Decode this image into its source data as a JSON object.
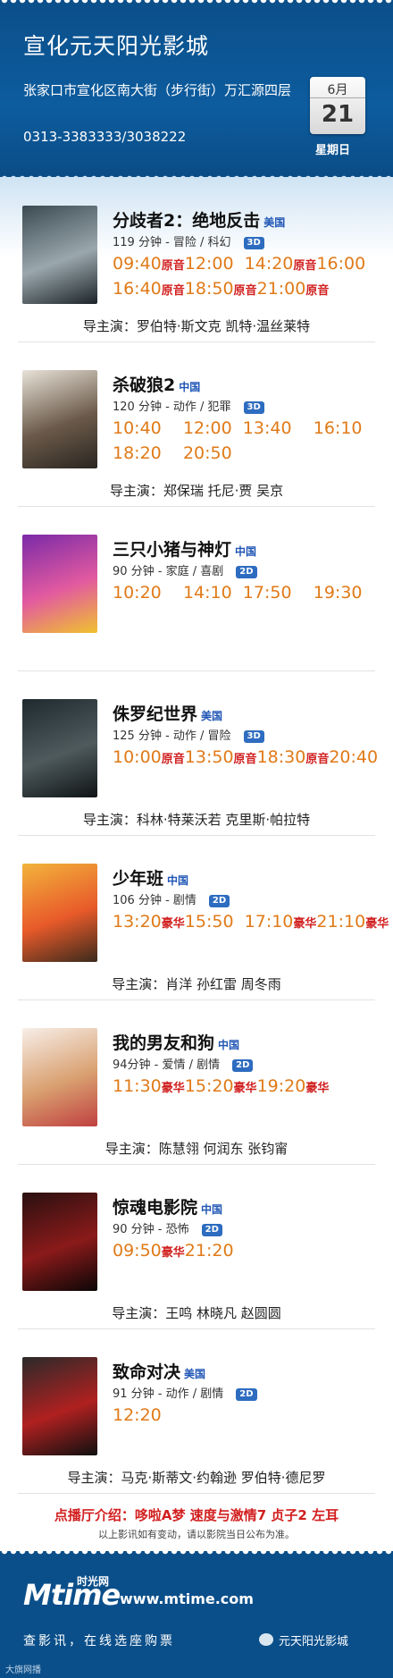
{
  "header": {
    "title": "宣化元天阳光影城",
    "address": "张家口市宣化区南大街（步行街）万汇源四层",
    "phone": "0313-3383333/3038222",
    "month": "6月",
    "day": "21",
    "weekday": "星期日"
  },
  "movies": [
    {
      "title": "分歧者2：绝地反击",
      "country": "美国",
      "meta": "119 分钟 - 冒险 / 科幻",
      "format": "3D",
      "poster_colors": [
        "#3b4a52",
        "#9aa7ad",
        "#1c2428"
      ],
      "times_line1": [
        "09:40",
        "原音",
        "12:00",
        "14:20",
        "原音",
        "16:00"
      ],
      "times_line2": [
        "16:40",
        "原音",
        "18:50",
        "原音",
        "21:00",
        "原音"
      ],
      "cast": "导主演：罗伯特·斯文克 凯特·温丝莱特"
    },
    {
      "title": "杀破狼2",
      "country": "中国",
      "meta": "120 分钟 - 动作 / 犯罪",
      "format": "3D",
      "poster_colors": [
        "#e8e2d8",
        "#6b5a4a",
        "#2a2520"
      ],
      "times_line1": [
        "10:40",
        "",
        "12:00",
        "13:40",
        "",
        "16:10"
      ],
      "times_line2": [
        "18:20",
        "",
        "20:50",
        "",
        "",
        ""
      ],
      "cast": "导主演：郑保瑞 托尼·贾 吴京"
    },
    {
      "title": "三只小猪与神灯",
      "country": "中国",
      "meta": "90 分钟 - 家庭 / 喜剧",
      "format": "2D",
      "poster_colors": [
        "#7a2aa8",
        "#e25aa0",
        "#f0c22e"
      ],
      "times_line1": [
        "10:20",
        "",
        "14:10",
        "17:50",
        "",
        "19:30"
      ],
      "times_line2": [],
      "cast": ""
    },
    {
      "title": "侏罗纪世界",
      "country": "美国",
      "meta": "125 分钟 - 动作 / 冒险",
      "format": "3D",
      "poster_colors": [
        "#1f2a2e",
        "#4e5a5c",
        "#0f1416"
      ],
      "times_line1": [
        "10:00",
        "原音",
        "13:50",
        "原音",
        "18:30",
        "原音",
        "20:40"
      ],
      "times_line2": [],
      "cast": "导主演：科林·特莱沃若 克里斯·帕拉特"
    },
    {
      "title": "少年班",
      "country": "中国",
      "meta": "106 分钟 - 剧情",
      "format": "2D",
      "poster_colors": [
        "#f2b33c",
        "#e85a2a",
        "#3b2a1c"
      ],
      "times_line1": [
        "13:20",
        "豪华",
        "15:50",
        "17:10",
        "豪华",
        "21:10",
        "豪华"
      ],
      "times_line2": [],
      "cast": "导主演：肖洋 孙红雷 周冬雨"
    },
    {
      "title": "我的男友和狗",
      "country": "中国",
      "meta": "94分钟 - 爱情 / 剧情",
      "format": "2D",
      "poster_colors": [
        "#f7eee8",
        "#d9a070",
        "#c04040"
      ],
      "times_line1": [
        "11:30",
        "豪华",
        "15:20",
        "豪华",
        "19:20",
        "豪华"
      ],
      "times_line2": [],
      "cast": "导主演：陈慧翎 何润东 张钧甯"
    },
    {
      "title": "惊魂电影院",
      "country": "中国",
      "meta": "90 分钟 - 恐怖",
      "format": "2D",
      "poster_colors": [
        "#2a1010",
        "#8a1a1a",
        "#0c0606"
      ],
      "times_line1": [
        "09:50",
        "豪华",
        "21:20"
      ],
      "times_line2": [],
      "cast": "导主演：王鸣 林晓凡 赵圆圆"
    },
    {
      "title": "致命对决",
      "country": "美国",
      "meta": "91 分钟 - 动作 / 剧情",
      "format": "2D",
      "poster_colors": [
        "#2a2a2a",
        "#b02020",
        "#101010"
      ],
      "times_line1": [
        "12:20"
      ],
      "times_line2": [],
      "cast": "导主演：马克·斯蒂文·约翰逊 罗伯特·德尼罗"
    }
  ],
  "notes": {
    "hall_intro": "点播厅介绍：哆啦A梦 速度与激情7 贞子2 左耳",
    "disclaimer": "以上影讯如有变动，请以影院当日公布为准。"
  },
  "footer": {
    "brand": "Mtime",
    "brand_cn": "时光网",
    "site": "www.mtime.com",
    "slogan": "查影讯，在线选座购票",
    "wechat": "元天阳光影城",
    "watermark": "大旗网播"
  },
  "colors": {
    "header_blue": "#0b4f8a",
    "time_orange": "#e07a18",
    "tag_red": "#d12020",
    "country_blue": "#1f55b5"
  }
}
